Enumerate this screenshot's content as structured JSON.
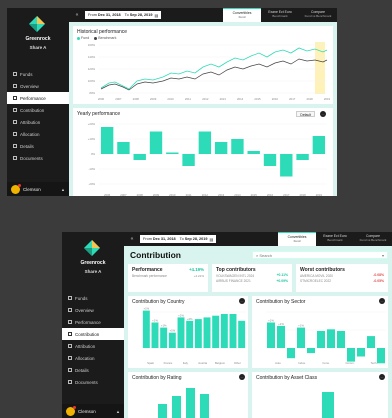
{
  "brand": {
    "name": "Greenrock",
    "fund": "Share A"
  },
  "user": {
    "name": "Clemson"
  },
  "nav": {
    "items1": [
      {
        "label": "Funds"
      },
      {
        "label": "Overview"
      },
      {
        "label": "Performance"
      },
      {
        "label": "Contribution"
      },
      {
        "label": "Attribution"
      },
      {
        "label": "Allocation"
      },
      {
        "label": "Details"
      },
      {
        "label": "Documents"
      }
    ]
  },
  "topbar": {
    "from_label": "From",
    "from_date": "Dec 31, 2018",
    "to_label": "To",
    "to_date": "Sep 28, 2019",
    "cal": "▤",
    "collapse": "«",
    "tabs": [
      {
        "label": "Convertibles",
        "sub": "Fund"
      },
      {
        "label": "Exane Ect Euro",
        "sub": "Benchmark"
      },
      {
        "label": "Compare",
        "sub": "Fund vs Benchmark"
      }
    ]
  },
  "screen1": {
    "historical_title": "Historical performance",
    "legend_fund": "Fund",
    "legend_bench": "Benchmark",
    "hist_y_ticks": [
      "160%",
      "140%",
      "120%",
      "100%",
      "80%"
    ],
    "hist_x_ticks": [
      "2006",
      "2007",
      "2008",
      "2009",
      "2010",
      "2011",
      "2012",
      "2013",
      "2014",
      "2015",
      "2016",
      "2017",
      "2018",
      "2019"
    ],
    "yearly_title": "Yearly performance",
    "default_label": "Default",
    "more": "···",
    "yearly_y_ticks": [
      "+20%",
      "+10%",
      "0%",
      "-10%",
      "-20%"
    ]
  },
  "screen2": {
    "title": "Contribution",
    "search_placeholder": "Search",
    "performance": {
      "title": "Performance",
      "sub": "Benchmark performance",
      "pct": "+4.19%",
      "pct2": "+4.21%"
    },
    "top": {
      "title": "Top contributors",
      "l1": "VOLKSWAGEN INTL 2024",
      "l2": "AIRBUS FINANCE 2021",
      "p1": "+0.11%",
      "p2": "+0.09%"
    },
    "worst": {
      "title": "Worst contributors",
      "l1": "AMERICA MOVIL 2020",
      "l2": "STMICROELEC 2022",
      "p1": "-0.08%",
      "p2": "-0.05%"
    },
    "by_country": "Contribution by Country",
    "by_sector": "Contribution by Sector",
    "by_rating": "Contribution by Rating",
    "by_asset": "Contribution by Asset Class",
    "more": "···",
    "country_cats": [
      "Spain",
      "France",
      "Italy",
      "Austria",
      "Belgium",
      "Other"
    ],
    "sector_cats": [
      "Auto",
      "Indus.",
      "Cons.",
      "Comm.",
      "Tech."
    ],
    "country_bar_labels": [
      "+1%",
      "+1%",
      "+1%",
      "+1%",
      "+2%",
      "+2%"
    ],
    "sector_bar_labels": [
      "+1%",
      "+1%",
      "+1%",
      "+1%",
      "+1%"
    ]
  },
  "chart_data": [
    {
      "type": "line",
      "series": [
        {
          "name": "Fund"
        },
        {
          "name": "Benchmark"
        }
      ]
    },
    {
      "type": "bar",
      "categories": [
        "2006",
        "2007",
        "2008",
        "2009",
        "2010",
        "2011",
        "2012",
        "2013",
        "2014",
        "2015",
        "2016",
        "2017",
        "2018",
        "2019"
      ],
      "values": [
        18,
        8,
        -4,
        15,
        1,
        -8,
        15,
        8,
        10,
        2,
        -8,
        -15,
        -4,
        12
      ],
      "ylim": [
        -20,
        20
      ]
    },
    {
      "type": "bar",
      "categories": [
        "Spain",
        "France",
        "Italy",
        "Austria",
        "Belgium",
        "Other"
      ],
      "values": [
        2.2,
        1.5,
        1.2,
        0.9,
        1.8,
        1.6,
        1.7,
        1.8,
        1.9,
        2.0,
        2.0,
        1.6
      ],
      "ylim": [
        -1,
        2
      ]
    },
    {
      "type": "bar",
      "categories": [
        "Auto",
        "Indus.",
        "Cons.",
        "Comm.",
        "Tech."
      ],
      "values": [
        1.5,
        1.3,
        -0.6,
        1.2,
        -0.3,
        1.0,
        1.1,
        1.0,
        -0.8,
        -0.5,
        0.7,
        -0.9
      ],
      "ylim": [
        -1,
        2
      ]
    }
  ]
}
